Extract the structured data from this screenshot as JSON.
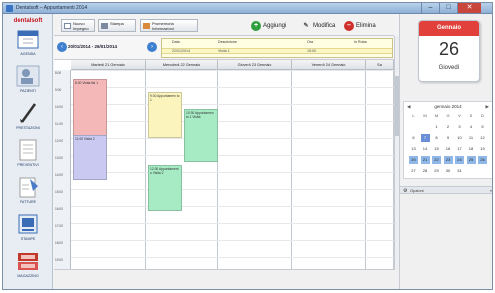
{
  "window": {
    "title": "Dentalsoft – Appuntamenti 2014"
  },
  "sidebar": {
    "logo": "dentalsoft",
    "items": [
      {
        "label": "AGENDA",
        "icon": "calendar-icon"
      },
      {
        "label": "PAZIENTI",
        "icon": "patients-icon"
      },
      {
        "label": "PRESTAZIONI",
        "icon": "pen-icon"
      },
      {
        "label": "PREVENTIVI",
        "icon": "document-icon"
      },
      {
        "label": "FATTURE",
        "icon": "invoice-icon"
      },
      {
        "label": "STAMPE",
        "icon": "printer-icon"
      },
      {
        "label": "MAGAZZINO",
        "icon": "warehouse-icon"
      }
    ]
  },
  "toolbar": {
    "new_label": "Nuovo Impegno",
    "print_label": "Stampa",
    "info_label": "Promemoria Informazioni",
    "add_label": "Aggiungi",
    "edit_label": "Modifica",
    "delete_label": "Elimina"
  },
  "range": {
    "text": "20/01/2014 - 26/01/2014"
  },
  "info": {
    "headers": [
      "Data",
      "Descrizione",
      "Ora",
      "In Ruba"
    ],
    "values": [
      "22/01/2014",
      "Visita 1",
      "15:00",
      ""
    ]
  },
  "calendar": {
    "days": [
      "Martedì 21 Gennaio",
      "Mercoledì 22 Gennaio",
      "Giovedì 23 Gennaio",
      "Venerdì 24 Gennaio",
      "Sa"
    ],
    "times": [
      "8:00",
      "9:00",
      "10:00",
      "11:00",
      "12:00",
      "13:00",
      "14:00",
      "15:00",
      "16:00",
      "17:00",
      "18:00",
      "19:00"
    ],
    "appointments": [
      {
        "text": "8:30 Visita fisi 1",
        "day": 0,
        "start": 0.5,
        "end": 4.2,
        "color": "#f4b8b8"
      },
      {
        "text": "11:00 Visita 2",
        "day": 0,
        "start": 3.8,
        "end": 6.5,
        "color": "#c9c9f1"
      },
      {
        "text": "9:30 Appuntamen to 1",
        "day": 1,
        "start": 1.3,
        "end": 4.0,
        "color": "#fbf5bd"
      },
      {
        "text": "10:30 Appuntamen to 1 Visita",
        "day": 1,
        "start": 2.3,
        "end": 5.4,
        "color": "#a6ebc4"
      },
      {
        "text": "12:30 Appuntament o Visita 2",
        "day": 1,
        "start": 5.6,
        "end": 8.3,
        "color": "#a6ebc4"
      }
    ]
  },
  "side": {
    "month_name": "Gennaio",
    "day_number": "26",
    "day_name": "Giovedì"
  },
  "minical": {
    "title": "gennaio 2014",
    "weekday_headers": [
      "L",
      "M",
      "M",
      "G",
      "V",
      "S",
      "D"
    ],
    "weeks": [
      [
        "",
        "",
        "1",
        "2",
        "3",
        "4",
        "5"
      ],
      [
        "6",
        "7",
        "8",
        "9",
        "10",
        "11",
        "12"
      ],
      [
        "13",
        "14",
        "15",
        "16",
        "17",
        "18",
        "19"
      ],
      [
        "20",
        "21",
        "22",
        "23",
        "24",
        "25",
        "26"
      ],
      [
        "27",
        "28",
        "29",
        "30",
        "31",
        "",
        ""
      ]
    ]
  },
  "options": {
    "label": "Opzioni"
  }
}
